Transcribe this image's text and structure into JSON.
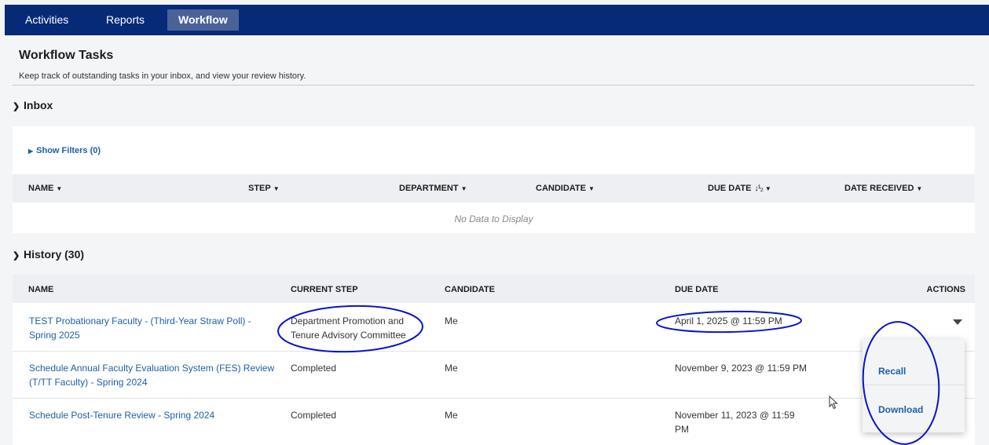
{
  "nav": {
    "tabs": [
      {
        "label": "Activities",
        "active": false
      },
      {
        "label": "Reports",
        "active": false
      },
      {
        "label": "Workflow",
        "active": true
      }
    ]
  },
  "page": {
    "title": "Workflow Tasks",
    "subtitle": "Keep track of outstanding tasks in your inbox, and view your review history."
  },
  "inbox": {
    "heading": "Inbox",
    "show_filters": "Show Filters (0)",
    "columns": [
      "NAME",
      "STEP",
      "DEPARTMENT",
      "CANDIDATE",
      "DUE DATE",
      "DATE RECEIVED"
    ],
    "empty_message": "No Data to Display"
  },
  "history": {
    "heading": "History (30)",
    "columns": [
      "NAME",
      "CURRENT STEP",
      "CANDIDATE",
      "DUE DATE",
      "ACTIONS"
    ],
    "rows": [
      {
        "name": "TEST Probationary Faculty - (Third-Year Straw Poll) - Spring 2025",
        "current_step": "Department Promotion and Tenure Advisory Committee",
        "candidate": "Me",
        "due_date": "April 1, 2025 @ 11:59 PM"
      },
      {
        "name": "Schedule Annual Faculty Evaluation System (FES) Review (T/TT Faculty) - Spring 2024",
        "current_step": "Completed",
        "candidate": "Me",
        "due_date": "November 9, 2023 @ 11:59 PM"
      },
      {
        "name": "Schedule Post-Tenure Review - Spring 2024",
        "current_step": "Completed",
        "candidate": "Me",
        "due_date": "November 11, 2023 @ 11:59 PM"
      }
    ]
  },
  "actions_menu": {
    "items": [
      "Recall",
      "Download"
    ]
  },
  "colors": {
    "nav_bg": "#062a78",
    "nav_active": "#4a6298",
    "link": "#1f5fa8",
    "annotation": "#0a14c8"
  }
}
